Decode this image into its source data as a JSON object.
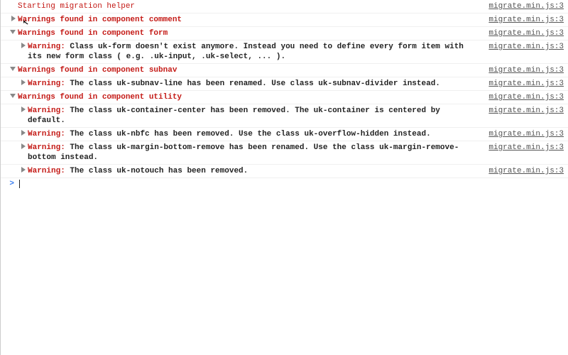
{
  "source_label": "migrate.min.js:3",
  "start_message": "Starting migration helper",
  "groups": [
    {
      "title": "Warnings found in component comment",
      "expanded": false,
      "items": []
    },
    {
      "title": "Warnings found in component form",
      "expanded": true,
      "items": [
        {
          "prefix": "Warning:",
          "text": "Class uk-form doesn't exist anymore. Instead you need to define every form item with its new form class ( e.g. .uk-input, .uk-select, ... )."
        }
      ]
    },
    {
      "title": "Warnings found in component subnav",
      "expanded": true,
      "items": [
        {
          "prefix": "Warning:",
          "text": "The class uk-subnav-line has been renamed. Use class uk-subnav-divider instead."
        }
      ]
    },
    {
      "title": "Warnings found in component utility",
      "expanded": true,
      "items": [
        {
          "prefix": "Warning:",
          "text": "The class uk-container-center has been removed. The uk-container is centered by default."
        },
        {
          "prefix": "Warning:",
          "text": "The class uk-nbfc has been removed. Use the class uk-overflow-hidden instead."
        },
        {
          "prefix": "Warning:",
          "text": "The class uk-margin-bottom-remove has been renamed. Use the class uk-margin-remove-bottom instead."
        },
        {
          "prefix": "Warning:",
          "text": "The class uk-notouch has been removed."
        }
      ]
    }
  ],
  "prompt_symbol": ">"
}
